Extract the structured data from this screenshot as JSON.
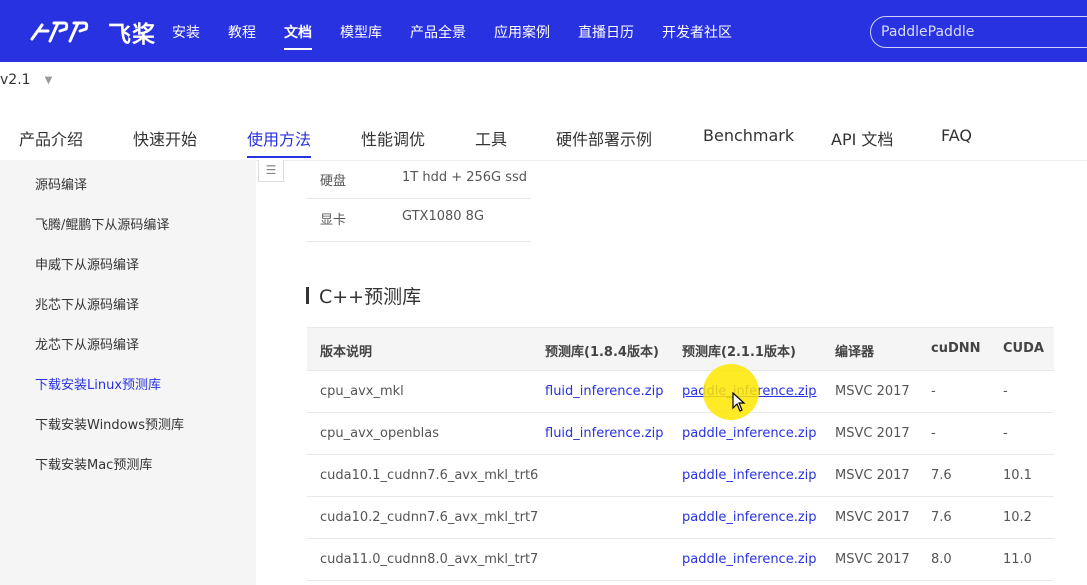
{
  "brand": {
    "logo_text": "飞桨"
  },
  "nav": {
    "items": [
      {
        "label": "安装"
      },
      {
        "label": "教程"
      },
      {
        "label": "文档"
      },
      {
        "label": "模型库"
      },
      {
        "label": "产品全景"
      },
      {
        "label": "应用案例"
      },
      {
        "label": "直播日历"
      },
      {
        "label": "开发者社区"
      }
    ],
    "active": "文档"
  },
  "search": {
    "value": "PaddlePaddle"
  },
  "version": {
    "label": "v2.1"
  },
  "subnav": {
    "items": [
      {
        "label": "产品介绍"
      },
      {
        "label": "快速开始"
      },
      {
        "label": "使用方法"
      },
      {
        "label": "性能调优"
      },
      {
        "label": "工具"
      },
      {
        "label": "硬件部署示例"
      },
      {
        "label": "Benchmark"
      },
      {
        "label": "API 文档"
      },
      {
        "label": "FAQ"
      }
    ],
    "active": "使用方法"
  },
  "sidebar": {
    "items": [
      {
        "label": "源码编译"
      },
      {
        "label": "飞腾/鲲鹏下从源码编译"
      },
      {
        "label": "申威下从源码编译"
      },
      {
        "label": "兆芯下从源码编译"
      },
      {
        "label": "龙芯下从源码编译"
      },
      {
        "label": "下载安装Linux预测库"
      },
      {
        "label": "下载安装Windows预测库"
      },
      {
        "label": "下载安装Mac预测库"
      }
    ],
    "active": "下载安装Linux预测库"
  },
  "hardware": {
    "rows": [
      {
        "key": "硬盘",
        "value": "1T hdd + 256G ssd"
      },
      {
        "key": "显卡",
        "value": "GTX1080 8G"
      }
    ]
  },
  "section": {
    "title": "C++预测库"
  },
  "table": {
    "headers": [
      "版本说明",
      "预测库(1.8.4版本)",
      "预测库(2.1.1版本)",
      "编译器",
      "cuDNN",
      "CUDA"
    ],
    "rows": [
      {
        "desc": "cpu_avx_mkl",
        "lib184": "fluid_inference.zip",
        "lib211": "paddle_inference.zip",
        "compiler": "MSVC 2017",
        "cudnn": "-",
        "cuda": "-"
      },
      {
        "desc": "cpu_avx_openblas",
        "lib184": "fluid_inference.zip",
        "lib211": "paddle_inference.zip",
        "compiler": "MSVC 2017",
        "cudnn": "-",
        "cuda": "-"
      },
      {
        "desc": "cuda10.1_cudnn7.6_avx_mkl_trt6",
        "lib184": "",
        "lib211": "paddle_inference.zip",
        "compiler": "MSVC 2017",
        "cudnn": "7.6",
        "cuda": "10.1"
      },
      {
        "desc": "cuda10.2_cudnn7.6_avx_mkl_trt7",
        "lib184": "",
        "lib211": "paddle_inference.zip",
        "compiler": "MSVC 2017",
        "cudnn": "7.6",
        "cuda": "10.2"
      },
      {
        "desc": "cuda11.0_cudnn8.0_avx_mkl_trt7",
        "lib184": "",
        "lib211": "paddle_inference.zip",
        "compiler": "MSVC 2017",
        "cudnn": "8.0",
        "cuda": "11.0"
      }
    ]
  },
  "colors": {
    "brand": "#2932e1",
    "highlight": "#ffe600"
  }
}
